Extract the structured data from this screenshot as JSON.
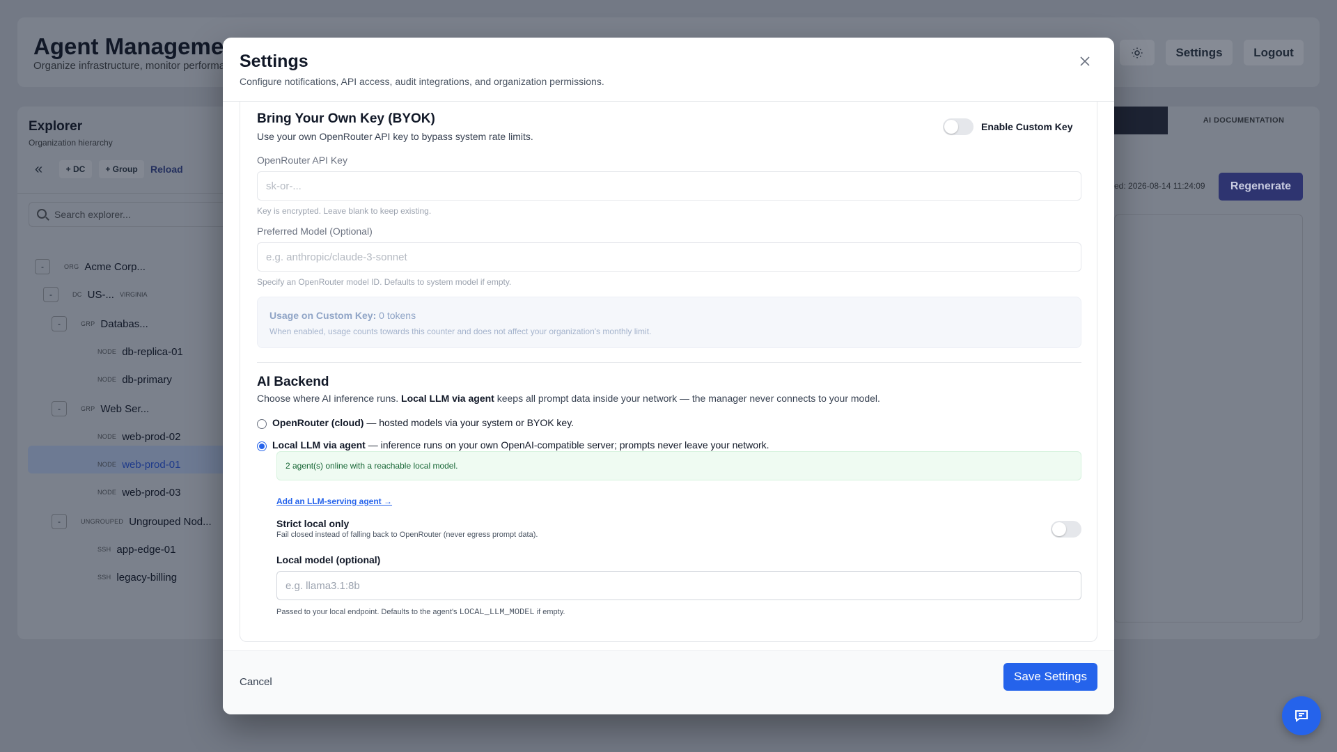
{
  "background": {
    "title": "Agent Management",
    "subtitle": "Organize infrastructure, monitor performance",
    "header_buttons": {
      "theme_icon": "sun-icon",
      "settings": "Settings",
      "logout": "Logout"
    },
    "explorer": {
      "title": "Explorer",
      "subtitle": "Organization hierarchy",
      "add_dc": "+ DC",
      "add_group": "+ Group",
      "reload": "Reload",
      "search_placeholder": "Search explorer...",
      "tree": [
        {
          "toggle": "-",
          "kind": "ORG",
          "name": "Acme Corp...",
          "meta": ""
        },
        {
          "toggle": "-",
          "kind": "DC",
          "name": "US-...",
          "meta": "VIRGINIA"
        },
        {
          "toggle": "-",
          "kind": "GRP",
          "name": "Databas...",
          "meta": ""
        },
        {
          "toggle": "",
          "kind": "NODE",
          "name": "db-replica-01",
          "meta": ""
        },
        {
          "toggle": "",
          "kind": "NODE",
          "name": "db-primary",
          "meta": ""
        },
        {
          "toggle": "-",
          "kind": "GRP",
          "name": "Web Ser...",
          "meta": ""
        },
        {
          "toggle": "",
          "kind": "NODE",
          "name": "web-prod-02",
          "meta": ""
        },
        {
          "toggle": "",
          "kind": "NODE",
          "name": "web-prod-01",
          "meta": ""
        },
        {
          "toggle": "",
          "kind": "NODE",
          "name": "web-prod-03",
          "meta": ""
        },
        {
          "toggle": "-",
          "kind": "UNGROUPED",
          "name": "Ungrouped Nod...",
          "meta": ""
        },
        {
          "toggle": "",
          "kind": "SSH",
          "name": "app-edge-01",
          "meta": ""
        },
        {
          "toggle": "",
          "kind": "SSH",
          "name": "legacy-billing",
          "meta": ""
        }
      ]
    },
    "docs": {
      "tab_label": "AI DOCUMENTATION",
      "generated": "ed: 2026-08-14 11:24:09",
      "regenerate": "Regenerate"
    }
  },
  "modal": {
    "title": "Settings",
    "description": "Configure notifications, API access, audit integrations, and organization permissions.",
    "close_icon": "close-icon",
    "byok": {
      "title": "Bring Your Own Key (BYOK)",
      "description": "Use your own OpenRouter API key to bypass system rate limits.",
      "toggle_label": "Enable Custom Key",
      "api_key_label": "OpenRouter API Key",
      "api_key_placeholder": "sk-or-...",
      "api_key_help": "Key is encrypted. Leave blank to keep existing.",
      "model_label": "Preferred Model (Optional)",
      "model_placeholder": "e.g. anthropic/claude-3-sonnet",
      "model_help": "Specify an OpenRouter model ID. Defaults to system model if empty.",
      "usage_label": "Usage on Custom Key:",
      "usage_value": "0 tokens",
      "usage_note": "When enabled, usage counts towards this counter and does not affect your organization's monthly limit."
    },
    "backend": {
      "title": "AI Backend",
      "desc_prefix": "Choose where AI inference runs. ",
      "desc_bold": "Local LLM via agent",
      "desc_suffix": " keeps all prompt data inside your network — the manager never connects to your model.",
      "option_cloud_bold": "OpenRouter (cloud)",
      "option_cloud_rest": " — hosted models via your system or BYOK key.",
      "option_local_bold": "Local LLM via agent",
      "option_local_rest": " — inference runs on your own OpenAI-compatible server; prompts never leave your network.",
      "status": "2 agent(s) online with a reachable local model.",
      "add_agent_link": "Add an LLM-serving agent →",
      "strict_label": "Strict local only",
      "strict_desc": "Fail closed instead of falling back to OpenRouter (never egress prompt data).",
      "local_model_label": "Local model (optional)",
      "local_model_placeholder": "e.g. llama3.1:8b",
      "local_help_prefix": "Passed to your local endpoint. Defaults to the agent's ",
      "local_help_code": "LOCAL_LLM_MODEL",
      "local_help_suffix": " if empty."
    },
    "footer": {
      "cancel": "Cancel",
      "save": "Save Settings"
    }
  },
  "fab": {
    "icon": "chat-icon"
  }
}
